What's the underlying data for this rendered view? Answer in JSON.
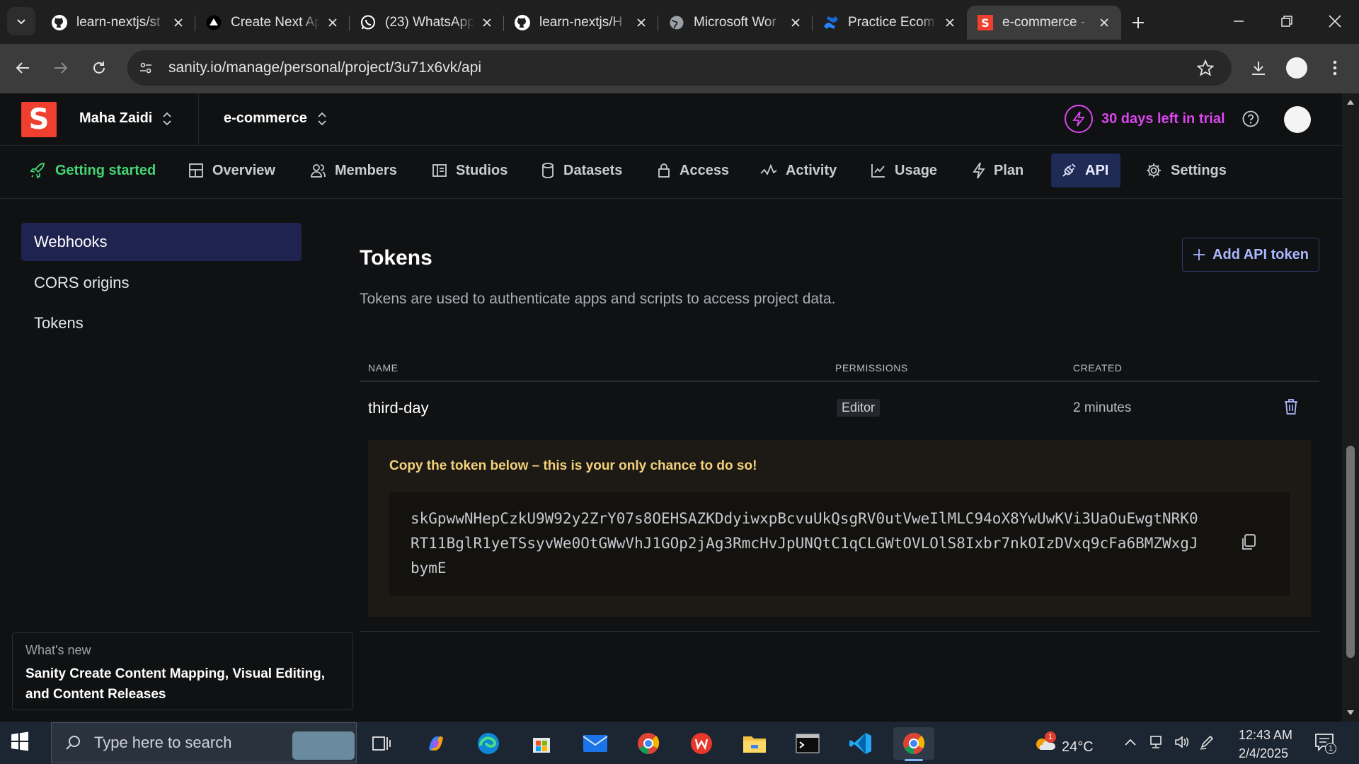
{
  "browser": {
    "tabs": [
      {
        "title": "learn-nextjs/st",
        "icon": "github-icon"
      },
      {
        "title": "Create Next Ap",
        "icon": "vercel-icon"
      },
      {
        "title": "(23) WhatsApp",
        "icon": "whatsapp-icon"
      },
      {
        "title": "learn-nextjs/H",
        "icon": "github-icon"
      },
      {
        "title": "Microsoft Wor",
        "icon": "globe-icon"
      },
      {
        "title": "Practice Ecom",
        "icon": "confluence-icon"
      },
      {
        "title": "e-commerce -",
        "icon": "sanity-icon",
        "active": true
      }
    ],
    "url": "sanity.io/manage/personal/project/3u71x6vk/api"
  },
  "header": {
    "logo_letter": "S",
    "org_name": "Maha Zaidi",
    "project_name": "e-commerce",
    "trial_text": "30 days left in trial",
    "accent_color": "#d946ef"
  },
  "nav": {
    "tabs": [
      {
        "label": "Getting started",
        "icon": "rocket-icon"
      },
      {
        "label": "Overview",
        "icon": "grid-icon"
      },
      {
        "label": "Members",
        "icon": "users-icon"
      },
      {
        "label": "Studios",
        "icon": "studio-icon"
      },
      {
        "label": "Datasets",
        "icon": "database-icon"
      },
      {
        "label": "Access",
        "icon": "lock-icon"
      },
      {
        "label": "Activity",
        "icon": "activity-icon"
      },
      {
        "label": "Usage",
        "icon": "chart-icon"
      },
      {
        "label": "Plan",
        "icon": "bolt-icon"
      },
      {
        "label": "API",
        "icon": "plug-icon",
        "active": true
      },
      {
        "label": "Settings",
        "icon": "gear-icon"
      }
    ]
  },
  "sidebar": {
    "items": [
      {
        "label": "Webhooks",
        "active": true
      },
      {
        "label": "CORS origins"
      },
      {
        "label": "Tokens"
      }
    ]
  },
  "whats_new": {
    "label": "What's new",
    "text": "Sanity Create Content Mapping, Visual Editing, and Content Releases"
  },
  "tokens": {
    "title": "Tokens",
    "description": "Tokens are used to authenticate apps and scripts to access project data.",
    "add_button": "Add API token",
    "columns": {
      "name": "NAME",
      "permissions": "PERMISSIONS",
      "created": "CREATED"
    },
    "rows": [
      {
        "name": "third-day",
        "permission": "Editor",
        "created": "2 minutes"
      }
    ],
    "warning": "Copy the token below – this is your only chance to do so!",
    "token_value": "skGpwwNHepCzkU9W92y2ZrY07s8OEHSAZKDdyiwxpBcvuUkQsgRV0utVweIlMLC94oX8YwUwKVi3UaOuEwgtNRK0RT11BglR1yeTSsyvWe0OtGWwVhJ1GOp2jAg3RmcHvJpUNQtC1qCLGWtOVLOlS8Ixbr7nkOIzDVxq9cFa6BMZWxgJbymE"
  },
  "taskbar": {
    "search_placeholder": "Type here to search",
    "temperature": "24°C",
    "weather_badge": "1",
    "time": "12:43 AM",
    "date": "2/4/2025",
    "notification_count": "1"
  }
}
